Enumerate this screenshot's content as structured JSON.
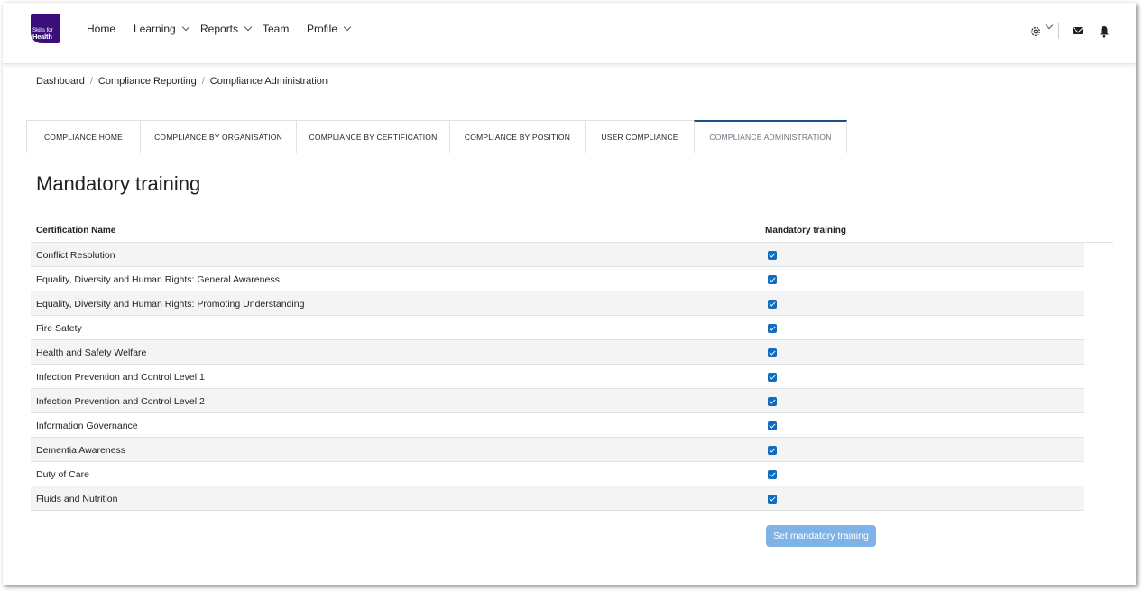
{
  "brand": {
    "line1": "Skills for",
    "line2": "Health"
  },
  "nav": {
    "home": "Home",
    "learning": "Learning",
    "reports": "Reports",
    "team": "Team",
    "profile": "Profile"
  },
  "breadcrumb": [
    "Dashboard",
    "Compliance Reporting",
    "Compliance Administration"
  ],
  "tabs": [
    "COMPLIANCE HOME",
    "COMPLIANCE BY ORGANISATION",
    "COMPLIANCE BY CERTIFICATION",
    "COMPLIANCE BY POSITION",
    "USER COMPLIANCE",
    "COMPLIANCE ADMINISTRATION"
  ],
  "active_tab": "COMPLIANCE ADMINISTRATION",
  "page_title": "Mandatory training",
  "table": {
    "columns": [
      "Certification Name",
      "Mandatory training"
    ],
    "rows": [
      {
        "name": "Conflict Resolution",
        "checked": true
      },
      {
        "name": "Equality, Diversity and Human Rights: General Awareness",
        "checked": true
      },
      {
        "name": "Equality, Diversity and Human Rights: Promoting Understanding",
        "checked": true
      },
      {
        "name": "Fire Safety",
        "checked": true
      },
      {
        "name": "Health and Safety Welfare",
        "checked": true
      },
      {
        "name": "Infection Prevention and Control Level 1",
        "checked": true
      },
      {
        "name": "Infection Prevention and Control Level 2",
        "checked": true
      },
      {
        "name": "Information Governance",
        "checked": true
      },
      {
        "name": "Dementia Awareness",
        "checked": true
      },
      {
        "name": "Duty of Care",
        "checked": true
      },
      {
        "name": "Fluids and Nutrition",
        "checked": true
      }
    ]
  },
  "submit_label": "Set mandatory training",
  "colors": {
    "brand": "#3a0f7a",
    "checkbox": "#0f6cbf",
    "button": "#7fb3e8",
    "active_tab_border": "#1e4d80"
  }
}
